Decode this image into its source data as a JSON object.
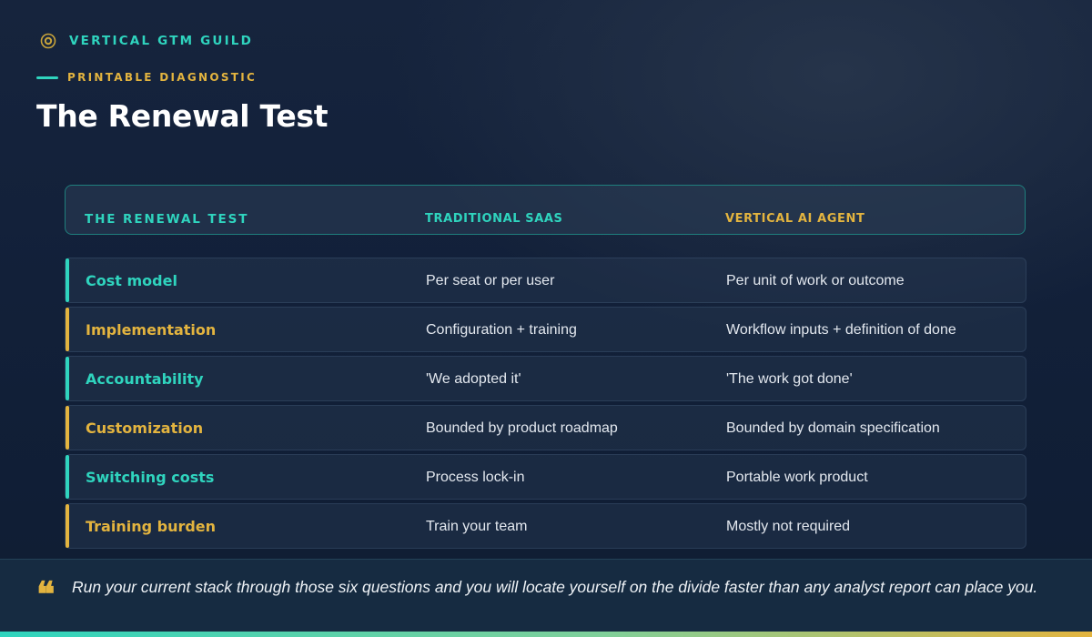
{
  "brand": {
    "name": "VERTICAL GTM GUILD",
    "icon": "guild-seal-icon"
  },
  "eyebrow": "PRINTABLE DIAGNOSTIC",
  "title": "The Renewal Test",
  "table": {
    "headers": [
      "THE RENEWAL TEST",
      "TRADITIONAL SAAS",
      "VERTICAL AI AGENT"
    ],
    "rows": [
      {
        "label": "Cost model",
        "traditional": "Per seat or per user",
        "vertical": "Per unit of work or outcome",
        "accent": "teal"
      },
      {
        "label": "Implementation",
        "traditional": "Configuration + training",
        "vertical": "Workflow inputs + definition of done",
        "accent": "gold"
      },
      {
        "label": "Accountability",
        "traditional": "'We adopted it'",
        "vertical": "'The work got done'",
        "accent": "teal"
      },
      {
        "label": "Customization",
        "traditional": "Bounded by product roadmap",
        "vertical": "Bounded by domain specification",
        "accent": "gold"
      },
      {
        "label": "Switching costs",
        "traditional": "Process lock-in",
        "vertical": "Portable work product",
        "accent": "teal"
      },
      {
        "label": "Training burden",
        "traditional": "Train your team",
        "vertical": "Mostly not required",
        "accent": "gold"
      }
    ]
  },
  "quote": {
    "mark": "❝",
    "text": "Run your current stack through those six questions and you will locate yourself on the divide faster than any analyst report can place you."
  },
  "colors": {
    "teal": "#2fd4be",
    "gold": "#e3b43f",
    "background": "#132139",
    "header_border": "#1f7f7d"
  }
}
